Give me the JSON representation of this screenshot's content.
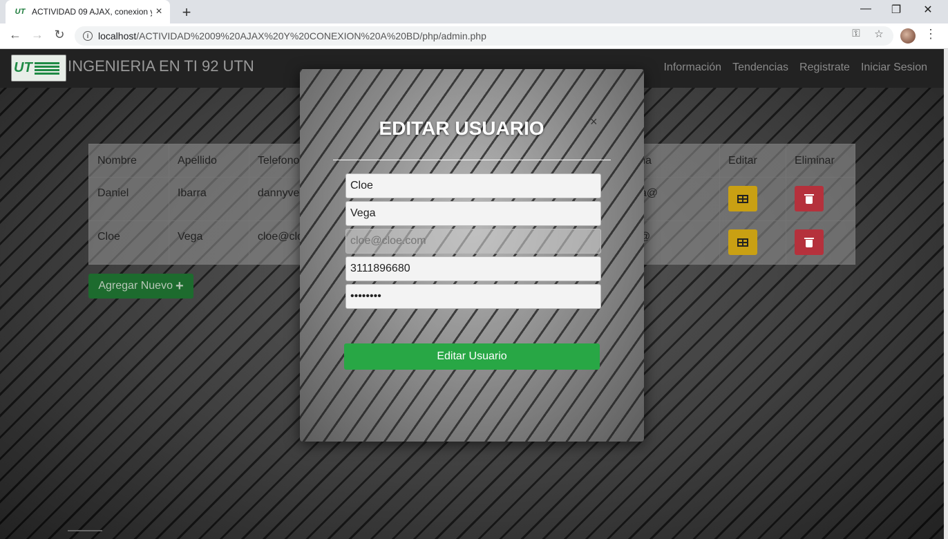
{
  "browser": {
    "tab_title": "ACTIVIDAD 09 AJAX, conexion y c",
    "tab_close": "×",
    "new_tab": "+",
    "window_controls": {
      "minimize": "—",
      "maximize": "❐",
      "close": "✕"
    },
    "nav": {
      "back": "←",
      "forward": "→",
      "reload": "↻"
    },
    "url_host": "localhost",
    "url_path": "/ACTIVIDAD%2009%20AJAX%20Y%20CONEXION%20A%20BD/php/admin.php",
    "icons": {
      "key": "key-icon",
      "star": "star-icon",
      "menu": "kebab-menu-icon"
    }
  },
  "navbar": {
    "logo_text": "UT",
    "brand": "INGENIERIA EN TI 92 UTN",
    "links": [
      "Información",
      "Tendencias",
      "Registrate",
      "Iniciar Sesion"
    ]
  },
  "table": {
    "headers": [
      "Nombre",
      "Apellido",
      "Telefono",
      "eña",
      "Editar",
      "Eliminar"
    ],
    "rows": [
      {
        "nombre": "Daniel",
        "apellido": "Ibarra",
        "col3": "dannyve",
        "col4": "Aa@"
      },
      {
        "nombre": "Cloe",
        "apellido": "Vega",
        "col3": "cloe@clo",
        "col4": "a@"
      }
    ],
    "colors": {
      "edit": "#c9a013",
      "delete": "#b5313c"
    }
  },
  "add_button": {
    "label": "Agregar Nuevo",
    "icon": "+"
  },
  "modal": {
    "title": "EDITAR USUARIO",
    "close": "×",
    "fields": {
      "nombre": "Cloe",
      "apellido": "Vega",
      "email_placeholder": "cloe@cloe.com",
      "telefono": "3111896680",
      "password": "cloe1234"
    },
    "submit_label": "Editar Usuario",
    "submit_color": "#28a745"
  }
}
